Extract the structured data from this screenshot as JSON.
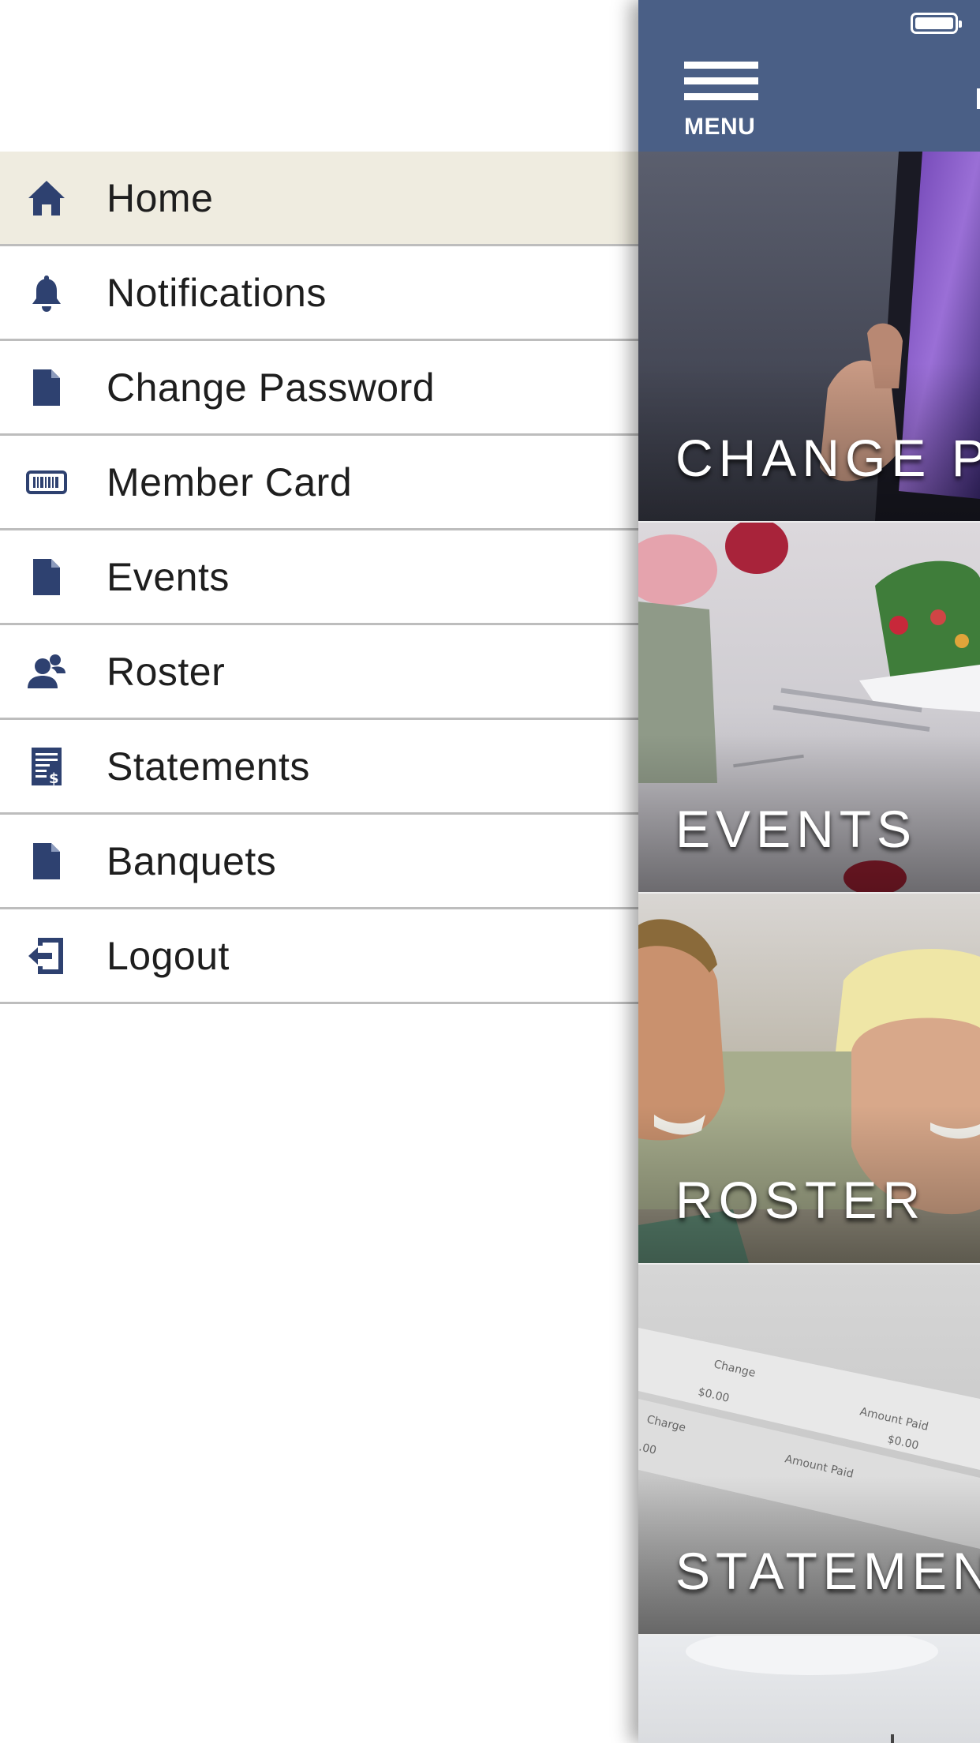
{
  "drawer": {
    "items": [
      {
        "label": "Home",
        "icon": "home-icon",
        "active": true
      },
      {
        "label": "Notifications",
        "icon": "bell-icon",
        "active": false
      },
      {
        "label": "Change Password",
        "icon": "document-icon",
        "active": false
      },
      {
        "label": "Member Card",
        "icon": "barcode-icon",
        "active": false
      },
      {
        "label": "Events",
        "icon": "document-icon",
        "active": false
      },
      {
        "label": "Roster",
        "icon": "people-icon",
        "active": false
      },
      {
        "label": "Statements",
        "icon": "statement-icon",
        "active": false
      },
      {
        "label": "Banquets",
        "icon": "document-icon",
        "active": false
      },
      {
        "label": "Logout",
        "icon": "logout-icon",
        "active": false
      }
    ]
  },
  "header": {
    "menu_label": "MENU"
  },
  "tiles": [
    {
      "title": "CHANGE PASSWORD"
    },
    {
      "title": "EVENTS"
    },
    {
      "title": "ROSTER"
    },
    {
      "title": "STATEMENTS"
    }
  ],
  "colors": {
    "icon": "#2e4170",
    "header": "#4a5f86",
    "active_row": "#efece0"
  }
}
